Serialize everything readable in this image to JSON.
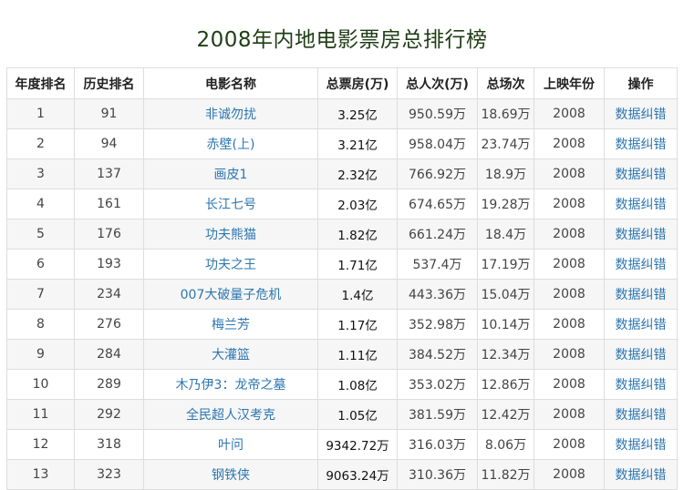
{
  "page": {
    "title": "2008年内地电影票房总排行榜"
  },
  "table": {
    "headers": [
      "年度排名",
      "历史排名",
      "电影名称",
      "总票房(万)",
      "总人次(万)",
      "总场次",
      "上映年份",
      "操作"
    ],
    "rows": [
      {
        "year_rank": "1",
        "hist_rank": "91",
        "name": "非诚勿扰",
        "box": "3.25亿",
        "audience": "950.59万",
        "shows": "18.69万",
        "year": "2008",
        "action": "数据纠错"
      },
      {
        "year_rank": "2",
        "hist_rank": "94",
        "name": "赤壁(上)",
        "box": "3.21亿",
        "audience": "958.04万",
        "shows": "23.74万",
        "year": "2008",
        "action": "数据纠错"
      },
      {
        "year_rank": "3",
        "hist_rank": "137",
        "name": "画皮1",
        "box": "2.32亿",
        "audience": "766.92万",
        "shows": "18.9万",
        "year": "2008",
        "action": "数据纠错"
      },
      {
        "year_rank": "4",
        "hist_rank": "161",
        "name": "长江七号",
        "box": "2.03亿",
        "audience": "674.65万",
        "shows": "19.28万",
        "year": "2008",
        "action": "数据纠错"
      },
      {
        "year_rank": "5",
        "hist_rank": "176",
        "name": "功夫熊猫",
        "box": "1.82亿",
        "audience": "661.24万",
        "shows": "18.4万",
        "year": "2008",
        "action": "数据纠错"
      },
      {
        "year_rank": "6",
        "hist_rank": "193",
        "name": "功夫之王",
        "box": "1.71亿",
        "audience": "537.4万",
        "shows": "17.19万",
        "year": "2008",
        "action": "数据纠错"
      },
      {
        "year_rank": "7",
        "hist_rank": "234",
        "name": "007大破量子危机",
        "box": "1.4亿",
        "audience": "443.36万",
        "shows": "15.04万",
        "year": "2008",
        "action": "数据纠错"
      },
      {
        "year_rank": "8",
        "hist_rank": "276",
        "name": "梅兰芳",
        "box": "1.17亿",
        "audience": "352.98万",
        "shows": "10.14万",
        "year": "2008",
        "action": "数据纠错"
      },
      {
        "year_rank": "9",
        "hist_rank": "284",
        "name": "大灌篮",
        "box": "1.11亿",
        "audience": "384.52万",
        "shows": "12.34万",
        "year": "2008",
        "action": "数据纠错"
      },
      {
        "year_rank": "10",
        "hist_rank": "289",
        "name": "木乃伊3：龙帝之墓",
        "box": "1.08亿",
        "audience": "353.02万",
        "shows": "12.86万",
        "year": "2008",
        "action": "数据纠错"
      },
      {
        "year_rank": "11",
        "hist_rank": "292",
        "name": "全民超人汉考克",
        "box": "1.05亿",
        "audience": "381.59万",
        "shows": "12.42万",
        "year": "2008",
        "action": "数据纠错"
      },
      {
        "year_rank": "12",
        "hist_rank": "318",
        "name": "叶问",
        "box": "9342.72万",
        "audience": "316.03万",
        "shows": "8.06万",
        "year": "2008",
        "action": "数据纠错"
      },
      {
        "year_rank": "13",
        "hist_rank": "323",
        "name": "钢铁侠",
        "box": "9063.24万",
        "audience": "310.36万",
        "shows": "11.82万",
        "year": "2008",
        "action": "数据纠错"
      }
    ]
  },
  "colors": {
    "title": "#1f3d14",
    "link": "#2d76b0",
    "border": "#dddddd",
    "stripe": "#f6f6f6"
  }
}
